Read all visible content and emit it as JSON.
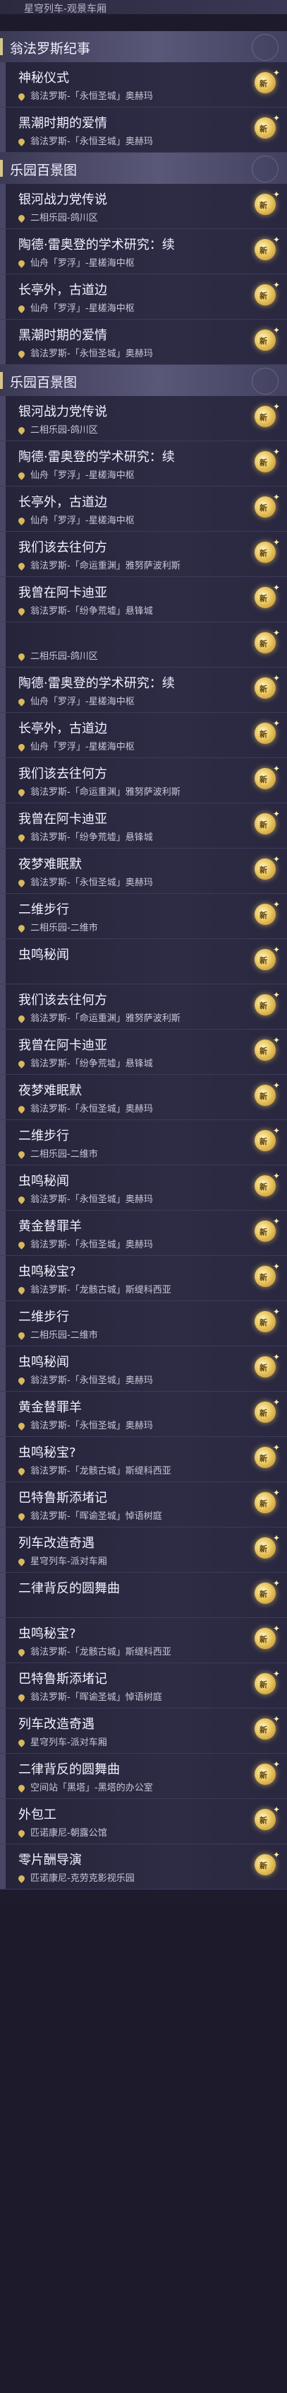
{
  "top_fragment": "星穹列车-观景车厢",
  "badge_new": "新",
  "colors": {
    "accent_gold": "#e9c660",
    "header_bg": "#4a4866",
    "item_bg": "#2a2840"
  },
  "icon": "new-entry-sparkle-icon",
  "rows": [
    {
      "type": "header",
      "text": "翁法罗斯纪事"
    },
    {
      "type": "item",
      "title": "神秘仪式",
      "loc": "翁法罗斯-「永恒圣城」奥赫玛"
    },
    {
      "type": "item",
      "title": "黑潮时期的爱情",
      "loc": "翁法罗斯-「永恒圣城」奥赫玛"
    },
    {
      "type": "header",
      "text": "乐园百景图"
    },
    {
      "type": "item",
      "title": "银河战力党传说",
      "loc": "二相乐园-鸽川区"
    },
    {
      "type": "item",
      "title": "陶德·雷奥登的学术研究：续",
      "loc": "仙舟「罗浮」-星槎海中枢"
    },
    {
      "type": "item",
      "title": "长亭外，古道边",
      "loc": "仙舟「罗浮」-星槎海中枢"
    },
    {
      "type": "item",
      "title": "黑潮时期的爱情",
      "loc": "翁法罗斯-「永恒圣城」奥赫玛"
    },
    {
      "type": "header",
      "text": "乐园百景图"
    },
    {
      "type": "item",
      "title": "银河战力党传说",
      "loc": "二相乐园-鸽川区"
    },
    {
      "type": "item",
      "title": "陶德·雷奥登的学术研究：续",
      "loc": "仙舟「罗浮」-星槎海中枢"
    },
    {
      "type": "item",
      "title": "长亭外，古道边",
      "loc": "仙舟「罗浮」-星槎海中枢"
    },
    {
      "type": "item",
      "title": "我们该去往何方",
      "loc": "翁法罗斯-「命运重渊」雅努萨波利斯"
    },
    {
      "type": "item",
      "title": "我曾在阿卡迪亚",
      "loc": "翁法罗斯-「纷争荒墟」悬锋城"
    },
    {
      "type": "item",
      "title": "",
      "loc": "二相乐园-鸽川区"
    },
    {
      "type": "item",
      "title": "陶德·雷奥登的学术研究：续",
      "loc": "仙舟「罗浮」-星槎海中枢"
    },
    {
      "type": "item",
      "title": "长亭外，古道边",
      "loc": "仙舟「罗浮」-星槎海中枢"
    },
    {
      "type": "item",
      "title": "我们该去往何方",
      "loc": "翁法罗斯-「命运重渊」雅努萨波利斯"
    },
    {
      "type": "item",
      "title": "我曾在阿卡迪亚",
      "loc": "翁法罗斯-「纷争荒墟」悬锋城"
    },
    {
      "type": "item",
      "title": "夜梦难眠默",
      "loc": "翁法罗斯-「永恒圣城」奥赫玛"
    },
    {
      "type": "item",
      "title": "二维步行",
      "loc": "二相乐园-二维市"
    },
    {
      "type": "item",
      "title": "虫鸣秘闻",
      "loc": ""
    },
    {
      "type": "item",
      "title": "我们该去往何方",
      "loc": "翁法罗斯-「命运重渊」雅努萨波利斯"
    },
    {
      "type": "item",
      "title": "我曾在阿卡迪亚",
      "loc": "翁法罗斯-「纷争荒墟」悬锋城"
    },
    {
      "type": "item",
      "title": "夜梦难眠默",
      "loc": "翁法罗斯-「永恒圣城」奥赫玛"
    },
    {
      "type": "item",
      "title": "二维步行",
      "loc": "二相乐园-二维市"
    },
    {
      "type": "item",
      "title": "虫鸣秘闻",
      "loc": "翁法罗斯-「永恒圣城」奥赫玛"
    },
    {
      "type": "item",
      "title": "黄金替罪羊",
      "loc": "翁法罗斯-「永恒圣城」奥赫玛"
    },
    {
      "type": "item",
      "title": "虫鸣秘宝?",
      "loc": "翁法罗斯-「龙骸古城」斯缇科西亚"
    },
    {
      "type": "item",
      "title": "二维步行",
      "loc": "二相乐园-二维市"
    },
    {
      "type": "item",
      "title": "虫鸣秘闻",
      "loc": "翁法罗斯-「永恒圣城」奥赫玛"
    },
    {
      "type": "item",
      "title": "黄金替罪羊",
      "loc": "翁法罗斯-「永恒圣城」奥赫玛"
    },
    {
      "type": "item",
      "title": "虫鸣秘宝?",
      "loc": "翁法罗斯-「龙骸古城」斯缇科西亚"
    },
    {
      "type": "item",
      "title": "巴特鲁斯添堵记",
      "loc": "翁法罗斯-「晖谕圣城」悼语树庭"
    },
    {
      "type": "item",
      "title": "列车改造奇遇",
      "loc": "星穹列车-派对车厢"
    },
    {
      "type": "item",
      "title": "二律背反的圆舞曲",
      "loc": ""
    },
    {
      "type": "item",
      "title": "虫鸣秘宝?",
      "loc": "翁法罗斯-「龙骸古城」斯缇科西亚"
    },
    {
      "type": "item",
      "title": "巴特鲁斯添堵记",
      "loc": "翁法罗斯-「晖谕圣城」悼语树庭"
    },
    {
      "type": "item",
      "title": "列车改造奇遇",
      "loc": "星穹列车-派对车厢"
    },
    {
      "type": "item",
      "title": "二律背反的圆舞曲",
      "loc": "空间站「黑塔」-黑塔的办公室"
    },
    {
      "type": "item",
      "title": "外包工",
      "loc": "匹诺康尼-朝露公馆"
    },
    {
      "type": "item",
      "title": "零片酬导演",
      "loc": "匹诺康尼-克劳克影视乐园"
    }
  ]
}
